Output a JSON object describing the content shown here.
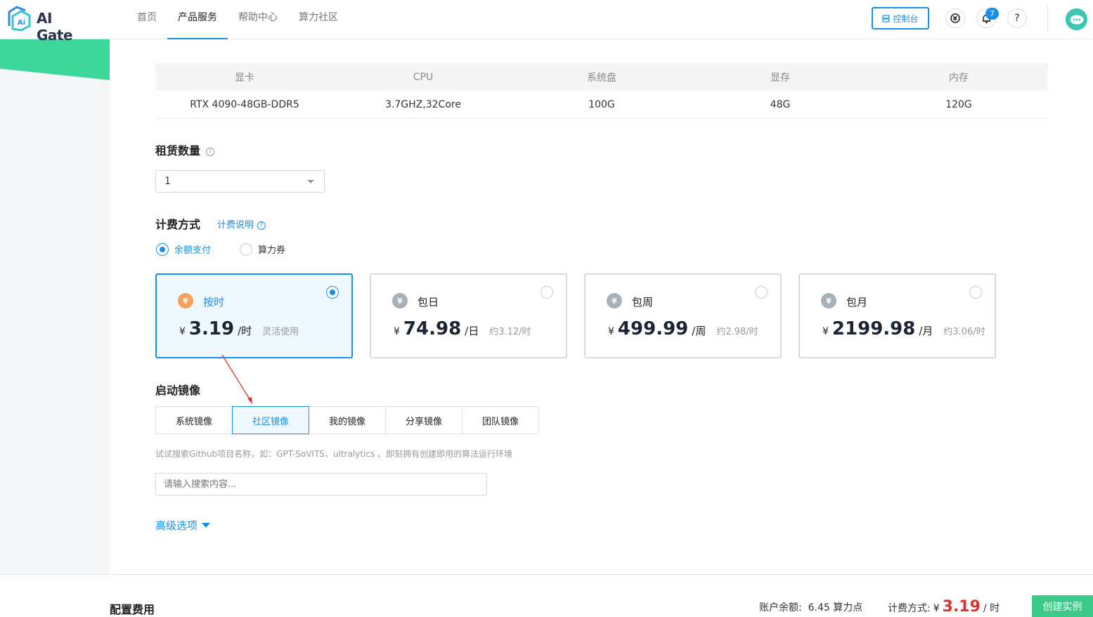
{
  "header": {
    "logo_text": "AI Gate",
    "nav": [
      "首页",
      "产品服务",
      "帮助中心",
      "算力社区"
    ],
    "active_nav": 1,
    "console_label": "控制台",
    "notification_count": "7",
    "help_icon": "?"
  },
  "table": {
    "headers": [
      "显卡",
      "CPU",
      "系统盘",
      "显存",
      "内存"
    ],
    "row": [
      "RTX 4090-48GB-DDR5",
      "3.7GHZ,32Core",
      "100G",
      "48G",
      "120G"
    ]
  },
  "rental": {
    "title": "租赁数量",
    "quantity": "1"
  },
  "billing": {
    "title": "计费方式",
    "explain_link": "计费说明",
    "pay_methods": [
      "余额支付",
      "算力券"
    ],
    "selected_pay_method": 0,
    "plans": [
      {
        "name": "按时",
        "currency": "¥",
        "price": "3.19",
        "unit": "/时",
        "note": "灵活使用",
        "selected": true
      },
      {
        "name": "包日",
        "currency": "¥",
        "price": "74.98",
        "unit": "/日",
        "note": "约3.12/时",
        "selected": false
      },
      {
        "name": "包周",
        "currency": "¥",
        "price": "499.99",
        "unit": "/周",
        "note": "约2.98/时",
        "selected": false
      },
      {
        "name": "包月",
        "currency": "¥",
        "price": "2199.98",
        "unit": "/月",
        "note": "约3.06/时",
        "selected": false
      }
    ],
    "icon_colors": {
      "selected": "#f5a35c",
      "default": "#a8b0b8"
    }
  },
  "image": {
    "title": "启动镜像",
    "tabs": [
      "系统镜像",
      "社区镜像",
      "我的镜像",
      "分享镜像",
      "团队镜像"
    ],
    "active_tab": 1,
    "hint": "试试搜索Github项目名称，如：GPT-SoVITS，ultralytics 。即刻拥有创建即用的算法运行环境",
    "search_placeholder": "请输入搜索内容...",
    "advanced_label": "高级选项"
  },
  "footer": {
    "title": "配置费用",
    "balance_label": "账户余额:",
    "balance_value": "6.45 算力点",
    "bill_label": "计费方式:",
    "bill_currency": "¥",
    "bill_amount": "3.19",
    "bill_unit": "/ 时",
    "create_label": "创建实例"
  },
  "colors": {
    "accent": "#1a8fe6",
    "green": "#3dd79b",
    "price_red": "#e0322d",
    "annotation_red": "#e0322d"
  }
}
